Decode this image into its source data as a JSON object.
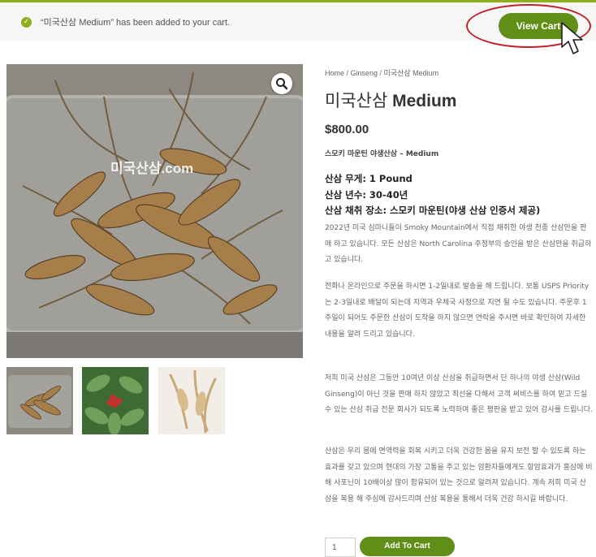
{
  "notice": {
    "message": "“미국산삼 Medium” has been added to your cart.",
    "view_cart_label": "View Cart"
  },
  "gallery": {
    "watermark": "미국산삼.com",
    "thumbnails": [
      "thumbnail-1",
      "thumbnail-2",
      "thumbnail-3"
    ]
  },
  "product": {
    "breadcrumb": "Home / Ginseng / 미국산삼 Medium",
    "title_prefix": "미국산삼 ",
    "title_suffix": "Medium",
    "price": "$800.00",
    "subtitle": "스모키 마운틴 야생산삼 – Medium",
    "spec_weight": "산삼 무게: 1 Pound",
    "spec_age": "산삼 년수: 30-40년",
    "spec_place": "산삼 채취 장소: 스모키 마운틴(야생 산삼 인증서 제공)",
    "paragraphs": [
      "2022년 미국 심마니들이 Smoky Mountain에서 직접 채취한 야생 천종 산삼만을 판매 하고 있습니다. 모든 산삼은 North Carolina 주정부의 승인을 받은 산삼만을 취급하고 있습니다.",
      "전화나 온라인으로 주문을 하시면 1-2일내로 발송을 해 드립니다. 보통 USPS Priority 는 2-3일내로 배달이 되는데 지역과 우체국 사정으로 지연 될 수도 있습니다. 주문후 1주일이 되어도 주문한 산삼이 도착을 하지 않으면 연락을 주시면 바로 확인하여 자세한 내용을 알려 드리고 있습니다.",
      "저희 미국 산삼은 그동안 10여년 이상 산삼을 취급하면서 단 하나의 야생 산삼(Wild Ginseng)이 아닌 것을 판매 하지 않았고 최선을 다해서 고객 써비스를 하여 믿고 드실 수 있는 산삼 취급 전문 회사가 되도록 노력하여 좋은 평판을 받고 있어 감사를 드립니다.",
      "산삼은 우리 몸에 면역력을 회복 시키고 더욱 건강한 몸을 유지 보전 할 수 있도록 하는 효과를 갖고 있으며 현대의 가장 고통을 주고 있는 암환자들에게도 항암효과가 홍삼에 비해 사포닌이 10배이상 많이 함유되어 있는 것으로 알려져 있습니다. 계속 저희 미국 산삼을 복용 해 주심에 감사드리며 산삼 복용을 통해서 더욱 건강 하시길 바랍니다."
    ],
    "quantity": "1",
    "add_to_cart_label": "Add To Cart"
  },
  "colors": {
    "accent_green": "#5f8f16",
    "notice_border": "#8fae1b",
    "annotation_red": "#c0202a"
  },
  "icons": {
    "notice": "check-circle-icon",
    "zoom": "magnifier-icon",
    "cursor": "mouse-pointer-icon"
  }
}
